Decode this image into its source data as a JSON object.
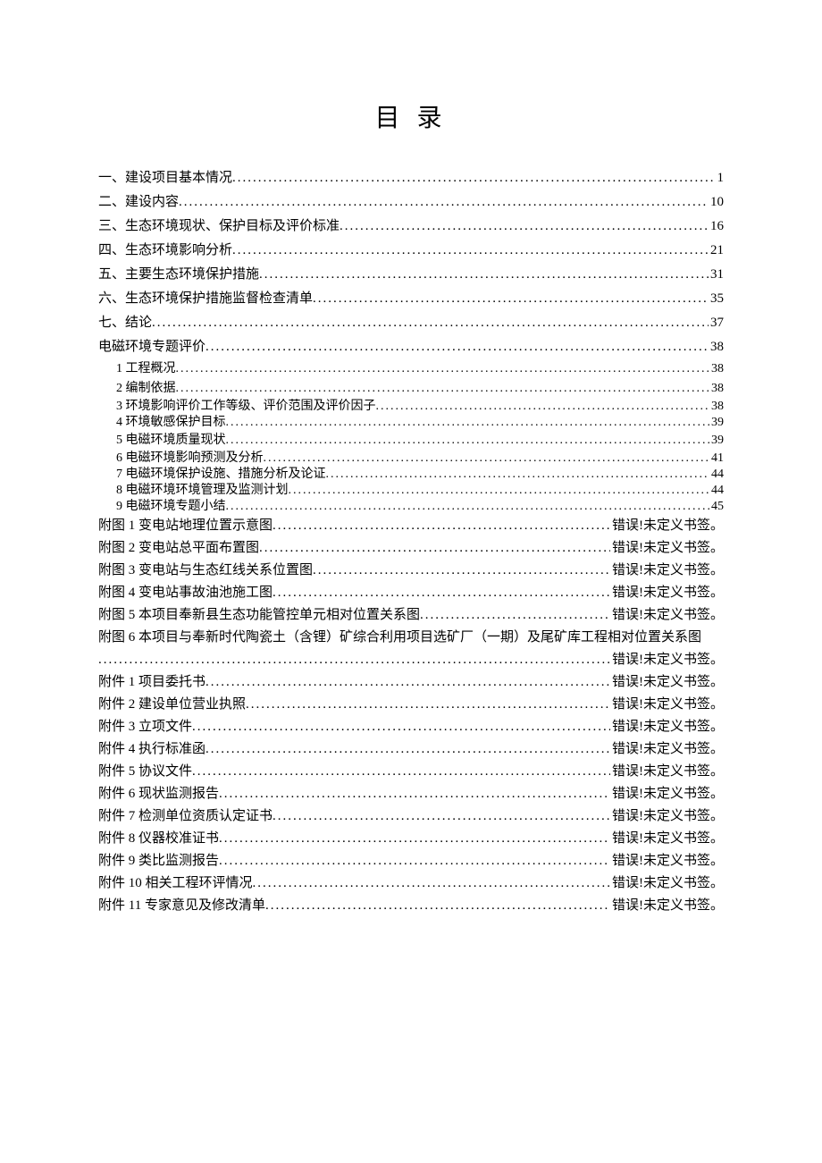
{
  "title": "目 录",
  "entries": [
    {
      "cls": "lvl1",
      "label": "一、建设项目基本情况",
      "page": "1"
    },
    {
      "cls": "lvl1",
      "label": "二、建设内容",
      "page": "10"
    },
    {
      "cls": "lvl1",
      "label": "三、生态环境现状、保护目标及评价标准",
      "page": "16"
    },
    {
      "cls": "lvl1",
      "label": "四、生态环境影响分析",
      "page": "21"
    },
    {
      "cls": "lvl1",
      "label": "五、主要生态环境保护措施",
      "page": "31"
    },
    {
      "cls": "lvl1",
      "label": "六、生态环境保护措施监督检查清单",
      "page": "35"
    },
    {
      "cls": "lvl1",
      "label": "七、结论",
      "page": "37"
    },
    {
      "cls": "lvl1",
      "label": "电磁环境专题评价",
      "page": "38"
    },
    {
      "cls": "lvl2",
      "label": "1 工程概况",
      "page": "38"
    },
    {
      "cls": "lvl2",
      "label": "2 编制依据",
      "page": "38"
    },
    {
      "cls": "lvl2 tight",
      "label": "3 环境影响评价工作等级、评价范围及评价因子",
      "page": "38"
    },
    {
      "cls": "lvl2 tight",
      "label": "4 环境敏感保护目标",
      "page": "39"
    },
    {
      "cls": "lvl2",
      "label": "5 电磁环境质量现状",
      "page": "39"
    },
    {
      "cls": "lvl2 tight",
      "label": "6 电磁环境影响预测及分析",
      "page": "41"
    },
    {
      "cls": "lvl2 tight",
      "label": "7 电磁环境保护设施、措施分析及论证",
      "page": "44"
    },
    {
      "cls": "lvl2 tight",
      "label": "8 电磁环境环境管理及监测计划",
      "page": "44"
    },
    {
      "cls": "lvl2 tight",
      "label": "9 电磁环境专题小结",
      "page": "45"
    },
    {
      "cls": "lvl1 att",
      "label": "附图 1 变电站地理位置示意图",
      "page": "错误!未定义书签。"
    },
    {
      "cls": "lvl1 att",
      "label": "附图 2 变电站总平面布置图",
      "page": "错误!未定义书签。"
    },
    {
      "cls": "lvl1 att",
      "label": "附图 3 变电站与生态红线关系位置图",
      "page": "错误!未定义书签。"
    },
    {
      "cls": "lvl1 att",
      "label": "附图 4 变电站事故油池施工图",
      "page": "错误!未定义书签。"
    },
    {
      "cls": "lvl1 att",
      "label": "附图 5 本项目奉新县生态功能管控单元相对位置关系图",
      "page": "错误!未定义书签。"
    },
    {
      "cls": "lvl1 att",
      "label": "附图 6 本项目与奉新时代陶瓷土（含锂）矿综合利用项目选矿厂（一期）及尾矿库工程相对位置关系图",
      "page": "错误!未定义书签。",
      "wrap": true
    },
    {
      "cls": "lvl1 att",
      "label": "附件 1 项目委托书",
      "page": "错误!未定义书签。"
    },
    {
      "cls": "lvl1 att",
      "label": "附件 2 建设单位营业执照",
      "page": "错误!未定义书签。"
    },
    {
      "cls": "lvl1 att",
      "label": "附件 3 立项文件",
      "page": "错误!未定义书签。"
    },
    {
      "cls": "lvl1 att",
      "label": "附件 4 执行标准函",
      "page": "错误!未定义书签。"
    },
    {
      "cls": "lvl1 att",
      "label": "附件 5 协议文件",
      "page": "错误!未定义书签。"
    },
    {
      "cls": "lvl1 att",
      "label": "附件 6 现状监测报告",
      "page": "错误!未定义书签。"
    },
    {
      "cls": "lvl1 att",
      "label": "附件 7 检测单位资质认定证书",
      "page": "错误!未定义书签。"
    },
    {
      "cls": "lvl1 att",
      "label": "附件 8 仪器校准证书",
      "page": "错误!未定义书签。"
    },
    {
      "cls": "lvl1 att",
      "label": "附件 9 类比监测报告",
      "page": "错误!未定义书签。"
    },
    {
      "cls": "lvl1 att",
      "label": "附件 10 相关工程环评情况",
      "page": "错误!未定义书签。"
    },
    {
      "cls": "lvl1 att",
      "label": "附件 11 专家意见及修改清单",
      "page": "错误!未定义书签。"
    }
  ]
}
